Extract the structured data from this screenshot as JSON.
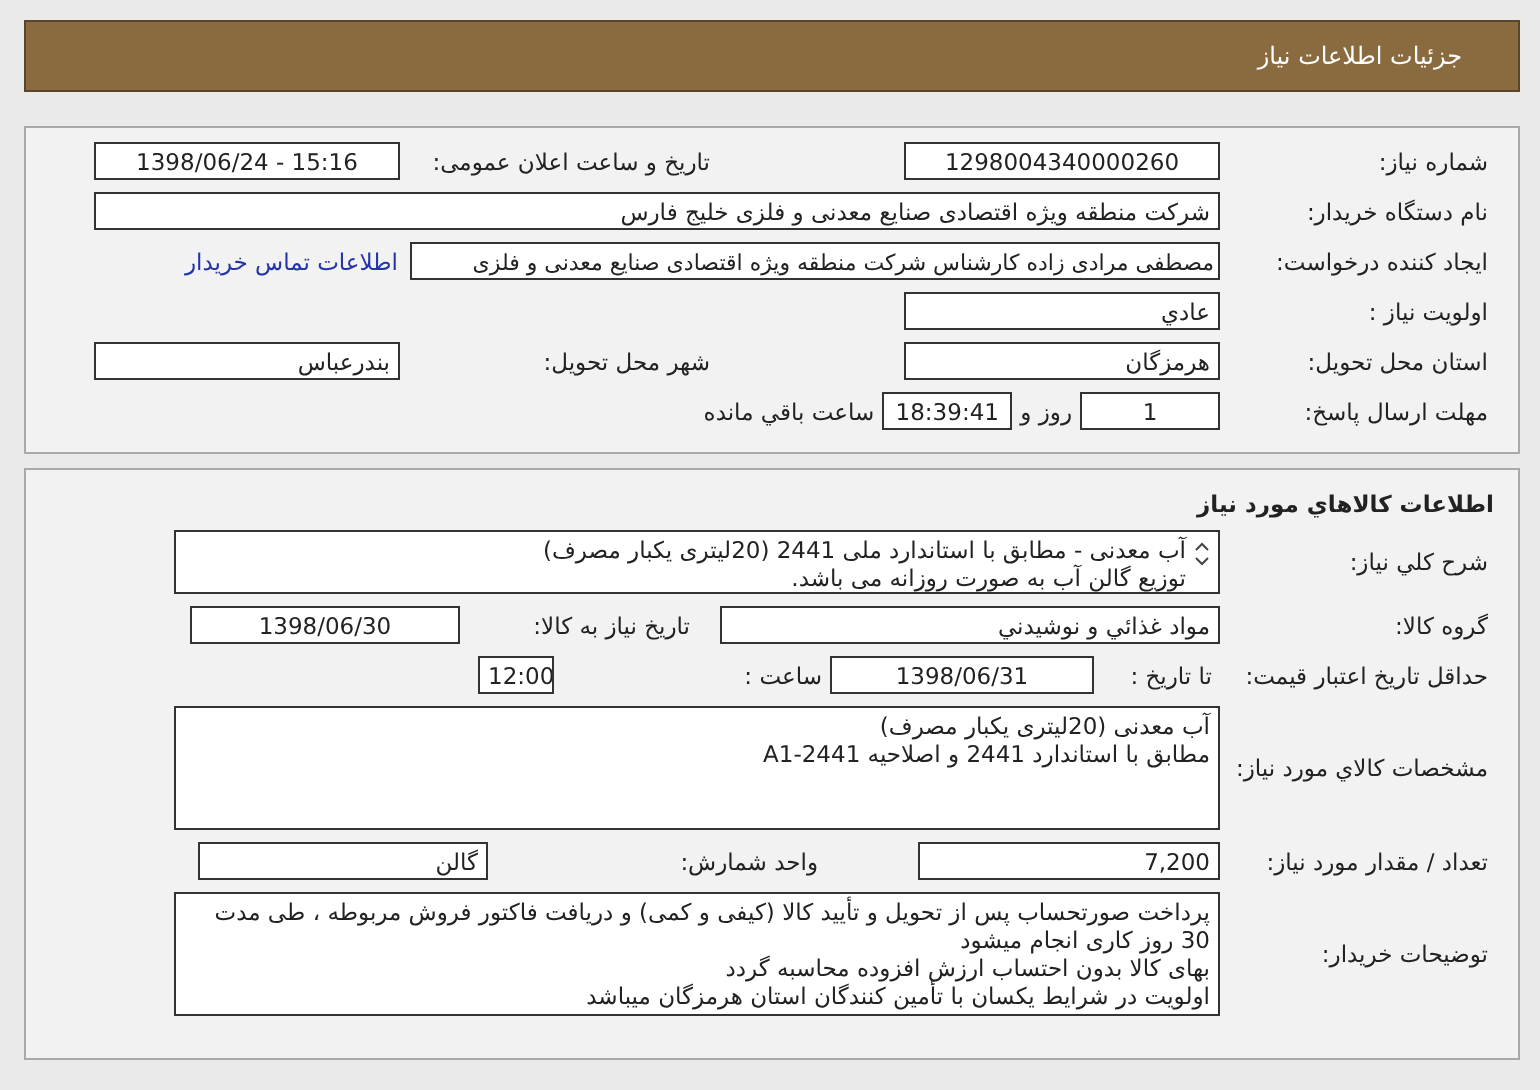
{
  "header": {
    "title": "جزئيات اطلاعات نیاز"
  },
  "request": {
    "number": {
      "label": "شماره نیاز:",
      "value": "1298004340000260"
    },
    "announce": {
      "label": "تاریخ و ساعت اعلان عمومی:",
      "value": "1398/06/24 - 15:16"
    },
    "buyer": {
      "label": "نام دستگاه خريدار:",
      "value": "شرکت منطقه ویژه اقتصادی صنایع معدنی و فلزی خلیج فارس"
    },
    "creator": {
      "label": "ايجاد کننده درخواست:",
      "value": "مصطفی مرادی زاده کارشناس شرکت منطقه ویژه اقتصادی صنایع معدنی و فلزی",
      "link": "اطلاعات تماس خريدار"
    },
    "priority": {
      "label": "اولويت نياز :",
      "value": "عادي"
    },
    "province": {
      "label": "استان محل تحويل:",
      "value": "هرمزگان"
    },
    "city": {
      "label": "شهر محل تحويل:",
      "value": "بندرعباس"
    },
    "deadline": {
      "label": "مهلت ارسال پاسخ:",
      "days": "1",
      "days_unit": "روز و",
      "time": "18:39:41",
      "time_unit": "ساعت باقي مانده"
    }
  },
  "goods": {
    "title": "اطلاعات کالاهاي مورد نياز",
    "summary": {
      "label": "شرح کلي نياز:",
      "lines": [
        "آب معدنی - مطابق با استاندارد ملی 2441 (20لیتری یکبار مصرف)",
        "توزیع گالن آب به صورت روزانه می باشد."
      ]
    },
    "group": {
      "label": "گروه کالا:",
      "value": "مواد غذائي و نوشيدني"
    },
    "need_date": {
      "label": "تاريخ نياز به کالا:",
      "value": "1398/06/30"
    },
    "validity": {
      "label": "حداقل تاريخ اعتبار قيمت:",
      "date_label": "تا تاريخ :",
      "date": "1398/06/31",
      "time_label": "ساعت :",
      "time": "12:00"
    },
    "specs": {
      "label": "مشخصات کالاي مورد نياز:",
      "lines": [
        "آب معدنی (20لیتری یکبار مصرف)",
        "مطابق با استاندارد 2441 و اصلاحیه A1-2441"
      ]
    },
    "quantity": {
      "label": "تعداد / مقدار مورد نياز:",
      "value": "7,200"
    },
    "unit": {
      "label": "واحد شمارش:",
      "value": "گالن"
    },
    "notes": {
      "label": "توضيحات خريدار:",
      "lines": [
        "پرداخت صورتحساب پس از تحویل و تأیید کالا (کیفی و کمی) و دریافت فاکتور فروش مربوطه ، طی مدت 30 روز کاری انجام میشود",
        "بهای کالا بدون احتساب ارزش افزوده محاسبه گردد",
        "اولویت در شرایط یکسان با تأمین کنندگان استان هرمزگان میباشد"
      ]
    }
  }
}
